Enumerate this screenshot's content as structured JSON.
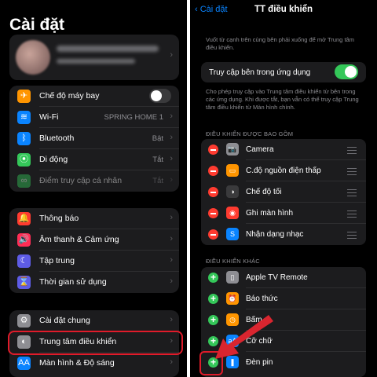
{
  "left": {
    "title": "Cài đặt",
    "groups": [
      [
        {
          "label": "Chế độ máy bay",
          "value": "",
          "icon": "airplane-icon",
          "color": "#ff9500",
          "glyph": "✈",
          "toggle": "off"
        },
        {
          "label": "Wi-Fi",
          "value": "SPRING HOME 1",
          "icon": "wifi-icon",
          "color": "#0a84ff",
          "glyph": "≋"
        },
        {
          "label": "Bluetooth",
          "value": "Bật",
          "icon": "bluetooth-icon",
          "color": "#0a84ff",
          "glyph": "ᛒ"
        },
        {
          "label": "Di động",
          "value": "Tắt",
          "icon": "cellular-icon",
          "color": "#34c759",
          "glyph": "⦿"
        },
        {
          "label": "Điểm truy cập cá nhân",
          "value": "Tắt",
          "icon": "hotspot-icon",
          "color": "#34c759",
          "glyph": "∞",
          "dim": true
        }
      ],
      [
        {
          "label": "Thông báo",
          "value": "",
          "icon": "bell-icon",
          "color": "#ff3b30",
          "glyph": "🔔"
        },
        {
          "label": "Âm thanh & Cảm ứng",
          "value": "",
          "icon": "speaker-icon",
          "color": "#ff2d55",
          "glyph": "🔊"
        },
        {
          "label": "Tập trung",
          "value": "",
          "icon": "moon-icon",
          "color": "#5e5ce6",
          "glyph": "☾"
        },
        {
          "label": "Thời gian sử dụng",
          "value": "",
          "icon": "hourglass-icon",
          "color": "#5e5ce6",
          "glyph": "⌛"
        }
      ],
      [
        {
          "label": "Cài đặt chung",
          "value": "",
          "icon": "gear-icon",
          "color": "#8e8e93",
          "glyph": "⚙"
        },
        {
          "label": "Trung tâm điều khiển",
          "value": "",
          "icon": "control-center-icon",
          "color": "#8e8e93",
          "glyph": "◐"
        },
        {
          "label": "Màn hình & Độ sáng",
          "value": "",
          "icon": "display-icon",
          "color": "#0a84ff",
          "glyph": "AA"
        }
      ]
    ]
  },
  "right": {
    "back_label": "Cài đặt",
    "title": "TT điều khiển",
    "intro": "Vuốt từ cạnh trên cùng bên phải xuống để mở Trung tâm điều khiển.",
    "access_label": "Truy cập bên trong ứng dụng",
    "access_desc": "Cho phép truy cập vào Trung tâm điều khiển từ bên trong các ứng dụng. Khi được tắt, bạn vẫn có thể truy cập Trung tâm điều khiển từ Màn hình chính.",
    "included_header": "ĐIỀU KHIỂN ĐƯỢC BAO GỒM",
    "included": [
      {
        "label": "Camera",
        "icon": "camera-icon",
        "color": "#8e8e93",
        "glyph": "📷"
      },
      {
        "label": "C.độ nguồn điện thấp",
        "icon": "battery-icon",
        "color": "#ff9500",
        "glyph": "▭"
      },
      {
        "label": "Chế độ tối",
        "icon": "dark-mode-icon",
        "color": "#3a3a3c",
        "glyph": "◑"
      },
      {
        "label": "Ghi màn hình",
        "icon": "record-icon",
        "color": "#ff3b30",
        "glyph": "◉"
      },
      {
        "label": "Nhận dạng nhạc",
        "icon": "shazam-icon",
        "color": "#0a84ff",
        "glyph": "S"
      }
    ],
    "more_header": "ĐIỀU KHIỂN KHÁC",
    "more": [
      {
        "label": "Apple TV Remote",
        "icon": "remote-icon",
        "color": "#8e8e93",
        "glyph": "▯"
      },
      {
        "label": "Báo thức",
        "icon": "alarm-icon",
        "color": "#ff9500",
        "glyph": "⏰"
      },
      {
        "label": "Bấm",
        "icon": "stopwatch-icon",
        "color": "#ff9500",
        "glyph": "◷"
      },
      {
        "label": "Cỡ chữ",
        "icon": "text-size-icon",
        "color": "#0a84ff",
        "glyph": "aA"
      },
      {
        "label": "Đèn pin",
        "icon": "flashlight-icon",
        "color": "#0a84ff",
        "glyph": "❚"
      }
    ]
  },
  "colors": {
    "highlight": "#e01b2a",
    "arrow": "#d9252f",
    "toggle_on": "#34c759"
  }
}
